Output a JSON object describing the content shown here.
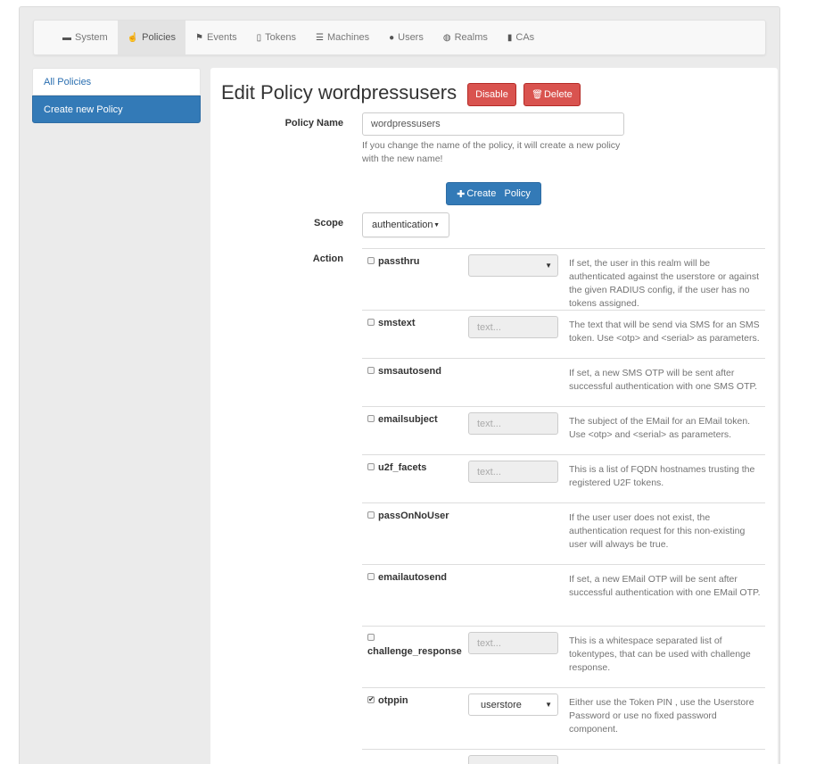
{
  "nav": {
    "items": [
      {
        "label": "System",
        "icon": "briefcase-icon",
        "glyph": "▬",
        "active": false
      },
      {
        "label": "Policies",
        "icon": "hand-icon",
        "glyph": "☝",
        "active": true
      },
      {
        "label": "Events",
        "icon": "flag-icon",
        "glyph": "⚑",
        "active": false
      },
      {
        "label": "Tokens",
        "icon": "phone-icon",
        "glyph": "▯",
        "active": false
      },
      {
        "label": "Machines",
        "icon": "list-icon",
        "glyph": "☰",
        "active": false
      },
      {
        "label": "Users",
        "icon": "user-icon",
        "glyph": "●",
        "active": false
      },
      {
        "label": "Realms",
        "icon": "globe-icon",
        "glyph": "◍",
        "active": false
      },
      {
        "label": "CAs",
        "icon": "bookmark-icon",
        "glyph": "▮",
        "active": false
      }
    ]
  },
  "sidebar": {
    "items": [
      {
        "label": "All Policies",
        "active": false
      },
      {
        "label": "Create new Policy",
        "active": true
      }
    ]
  },
  "page": {
    "title": "Edit Policy wordpressusers",
    "disable_label": "Disable",
    "delete_label": "Delete",
    "delete_glyph": "🗑",
    "create_label": "Create   Policy",
    "create_glyph": "✚"
  },
  "form": {
    "policy_name_label": "Policy Name",
    "policy_name_value": "wordpressusers",
    "policy_name_help": "If you change the name of the policy, it will create a new policy with the new name!",
    "scope_label": "Scope",
    "scope_value": "authentication",
    "action_label": "Action"
  },
  "actions": [
    {
      "name": "passthru",
      "checked": false,
      "control": "select",
      "value": "",
      "desc": "If set, the user in this realm will be authenticated against the userstore or against the given RADIUS config, if the user has no tokens assigned."
    },
    {
      "name": "smstext",
      "checked": false,
      "control": "text",
      "placeholder": "text...",
      "desc": "The text that will be send via SMS for an SMS token. Use <otp> and <serial> as parameters."
    },
    {
      "name": "smsautosend",
      "checked": false,
      "control": "none",
      "desc": "If set, a new SMS OTP will be sent after successful authentication with one SMS OTP."
    },
    {
      "name": "emailsubject",
      "checked": false,
      "control": "text",
      "placeholder": "text...",
      "desc": "The subject of the EMail for an EMail token. Use <otp> and <serial> as parameters."
    },
    {
      "name": "u2f_facets",
      "checked": false,
      "control": "text",
      "placeholder": "text...",
      "desc": "This is a list of FQDN hostnames trusting the registered U2F tokens."
    },
    {
      "name": "passOnNoUser",
      "checked": false,
      "control": "none",
      "desc": "If the user user does not exist, the authentication request for this non-existing user will always be true."
    },
    {
      "name": "emailautosend",
      "checked": false,
      "control": "none",
      "desc": "If set, a new EMail OTP will be sent after successful authentication with one EMail OTP."
    },
    {
      "name": "challenge_response",
      "checked": false,
      "control": "text",
      "placeholder": "text...",
      "desc": "This is a whitespace separated list of tokentypes, that can be used with challenge response."
    },
    {
      "name": "otppin",
      "checked": true,
      "control": "select2",
      "value": "userstore",
      "desc": "Either use the Token PIN , use the Userstore Password or use no fixed password component."
    }
  ]
}
